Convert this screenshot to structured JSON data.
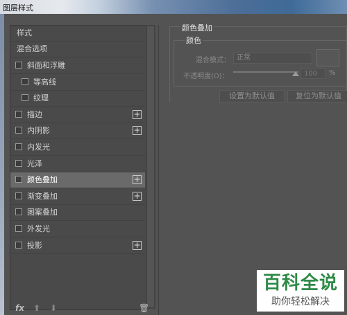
{
  "window": {
    "title": "图层样式"
  },
  "sidebar": {
    "header": "样式",
    "blend_options": "混合选项",
    "items": [
      {
        "label": "斜面和浮雕",
        "checked": false,
        "indent": 0,
        "has_plus": false,
        "selected": false
      },
      {
        "label": "等高线",
        "checked": false,
        "indent": 1,
        "has_plus": false,
        "selected": false
      },
      {
        "label": "纹理",
        "checked": false,
        "indent": 1,
        "has_plus": false,
        "selected": false
      },
      {
        "label": "描边",
        "checked": false,
        "indent": 0,
        "has_plus": true,
        "selected": false
      },
      {
        "label": "内阴影",
        "checked": false,
        "indent": 0,
        "has_plus": true,
        "selected": false
      },
      {
        "label": "内发光",
        "checked": false,
        "indent": 0,
        "has_plus": false,
        "selected": false
      },
      {
        "label": "光泽",
        "checked": false,
        "indent": 0,
        "has_plus": false,
        "selected": false
      },
      {
        "label": "颜色叠加",
        "checked": false,
        "indent": 0,
        "has_plus": true,
        "selected": true
      },
      {
        "label": "渐变叠加",
        "checked": false,
        "indent": 0,
        "has_plus": true,
        "selected": false
      },
      {
        "label": "图案叠加",
        "checked": false,
        "indent": 0,
        "has_plus": false,
        "selected": false
      },
      {
        "label": "外发光",
        "checked": false,
        "indent": 0,
        "has_plus": false,
        "selected": false
      },
      {
        "label": "投影",
        "checked": false,
        "indent": 0,
        "has_plus": true,
        "selected": false
      }
    ],
    "plus_glyph": "+",
    "fx_label": "fx",
    "up_glyph": "⬆",
    "down_glyph": "⬇",
    "trash_glyph": "🗑"
  },
  "panel": {
    "group_title": "颜色叠加",
    "sub_title": "颜色",
    "blend_mode_label": "混合模式：",
    "blend_mode_value": "正常",
    "opacity_label": "不透明度(O)：",
    "opacity_value": "100",
    "opacity_unit": "%",
    "set_default_button": "设置为默认值",
    "reset_default_button": "复位为默认值"
  },
  "watermark": {
    "brand": "百科全说",
    "slogan": "助你轻松解决"
  }
}
